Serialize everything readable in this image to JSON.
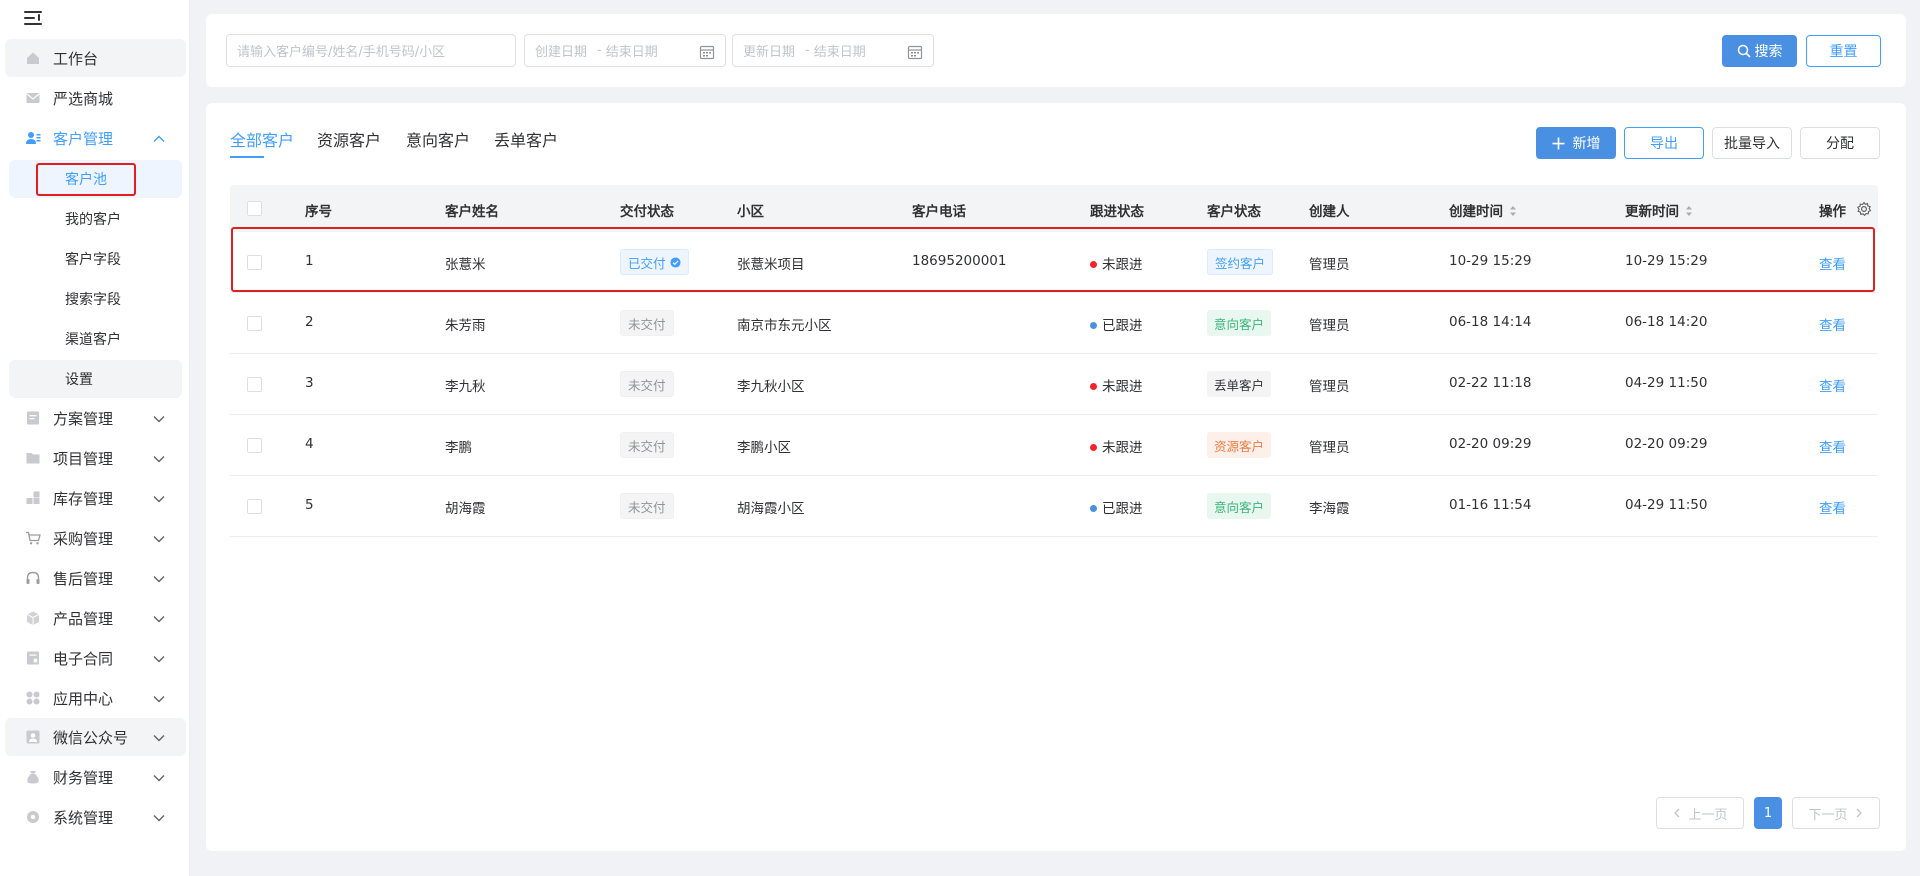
{
  "sidebar": {
    "items": [
      {
        "label": "工作台"
      },
      {
        "label": "严选商城"
      },
      {
        "label": "客户管理"
      },
      {
        "label": "方案管理"
      },
      {
        "label": "项目管理"
      },
      {
        "label": "库存管理"
      },
      {
        "label": "采购管理"
      },
      {
        "label": "售后管理"
      },
      {
        "label": "产品管理"
      },
      {
        "label": "电子合同"
      },
      {
        "label": "应用中心"
      },
      {
        "label": "微信公众号"
      },
      {
        "label": "财务管理"
      },
      {
        "label": "系统管理"
      }
    ],
    "sub_items": [
      {
        "label": "客户池"
      },
      {
        "label": "我的客户"
      },
      {
        "label": "客户字段"
      },
      {
        "label": "搜索字段"
      },
      {
        "label": "渠道客户"
      },
      {
        "label": "设置"
      }
    ]
  },
  "search": {
    "keyword_placeholder": "请输入客户编号/姓名/手机号码/小区",
    "created_start": "创建日期",
    "created_end": "结束日期",
    "updated_start": "更新日期",
    "updated_end": "结束日期",
    "date_separator": "-",
    "search_label": "搜索",
    "reset_label": "重置"
  },
  "tabs": [
    {
      "label": "全部客户"
    },
    {
      "label": "资源客户"
    },
    {
      "label": "意向客户"
    },
    {
      "label": "丢单客户"
    }
  ],
  "toolbar": {
    "add_label": "新增",
    "export_label": "导出",
    "import_label": "批量导入",
    "assign_label": "分配"
  },
  "table": {
    "headers": [
      "序号",
      "客户姓名",
      "交付状态",
      "小区",
      "客户电话",
      "跟进状态",
      "客户状态",
      "创建人",
      "创建时间",
      "更新时间",
      "操作"
    ],
    "rows": [
      {
        "no": "1",
        "name": "张薏米",
        "delivery": "已交付",
        "community": "张薏米项目",
        "phone": "18695200001",
        "follow": "未跟进",
        "status": "签约客户",
        "creator": "管理员",
        "created": "10-29 15:29",
        "updated": "10-29 15:29",
        "action": "查看"
      },
      {
        "no": "2",
        "name": "朱芳雨",
        "delivery": "未交付",
        "community": "南京市东元小区",
        "phone": "",
        "follow": "已跟进",
        "status": "意向客户",
        "creator": "管理员",
        "created": "06-18 14:14",
        "updated": "06-18 14:20",
        "action": "查看"
      },
      {
        "no": "3",
        "name": "李九秋",
        "delivery": "未交付",
        "community": "李九秋小区",
        "phone": "",
        "follow": "未跟进",
        "status": "丢单客户",
        "creator": "管理员",
        "created": "02-22 11:18",
        "updated": "04-29 11:50",
        "action": "查看"
      },
      {
        "no": "4",
        "name": "李鹏",
        "delivery": "未交付",
        "community": "李鹏小区",
        "phone": "",
        "follow": "未跟进",
        "status": "资源客户",
        "creator": "管理员",
        "created": "02-20 09:29",
        "updated": "02-20 09:29",
        "action": "查看"
      },
      {
        "no": "5",
        "name": "胡海霞",
        "delivery": "未交付",
        "community": "胡海霞小区",
        "phone": "",
        "follow": "已跟进",
        "status": "意向客户",
        "creator": "李海霞",
        "created": "01-16 11:54",
        "updated": "04-29 11:50",
        "action": "查看"
      }
    ]
  },
  "pagination": {
    "prev_label": "上一页",
    "current_page": "1",
    "next_label": "下一页"
  },
  "colors": {
    "accent": "#409eff",
    "primary_button": "#4a90e2",
    "highlight_box": "#e02020",
    "dot_red": "#f5222d",
    "dot_blue": "#4a90e2"
  }
}
